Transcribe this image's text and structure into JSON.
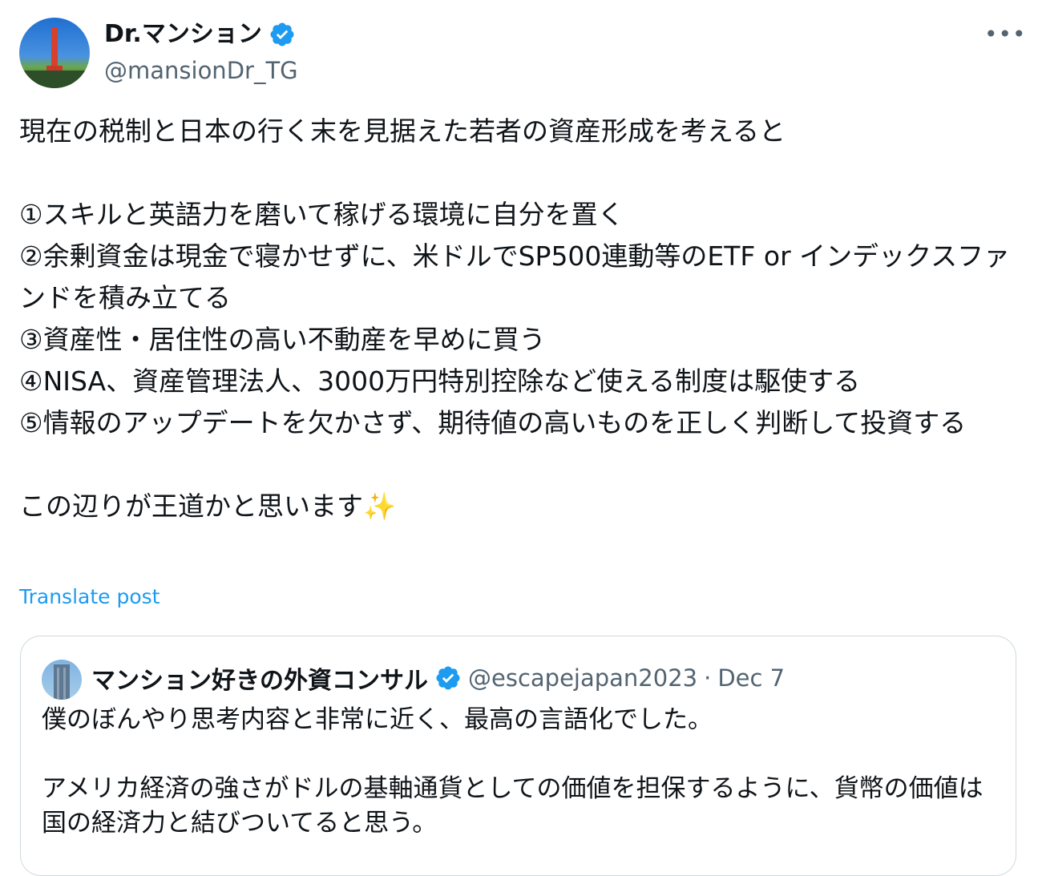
{
  "author": {
    "name": "Dr.マンション",
    "handle": "@mansionDr_TG"
  },
  "more_label": "•••",
  "post_text": "現在の税制と日本の行く末を見据えた若者の資産形成を考えると\n\n①スキルと英語力を磨いて稼げる環境に自分を置く\n②余剰資金は現金で寝かせずに、米ドルでSP500連動等のETF or インデックスファンドを積み立てる\n③資産性・居住性の高い不動産を早めに買う\n④NISA、資産管理法人、3000万円特別控除など使える制度は駆使する\n⑤情報のアップデートを欠かさず、期待値の高いものを正しく判断して投資する\n\nこの辺りが王道かと思います✨",
  "translate_label": "Translate post",
  "quoted": {
    "name": "マンション好きの外資コンサル",
    "handle": "@escapejapan2023",
    "separator": "·",
    "date": "Dec 7",
    "text": "僕のぼんやり思考内容と非常に近く、最高の言語化でした。\n\nアメリカ経済の強さがドルの基軸通貨としての価値を担保するように、貨幣の価値は国の経済力と結びついてると思う。"
  },
  "colors": {
    "verified": "#1d9bf0",
    "link": "#1d9bf0",
    "secondary_text": "#536471",
    "border": "#cfd9de"
  }
}
